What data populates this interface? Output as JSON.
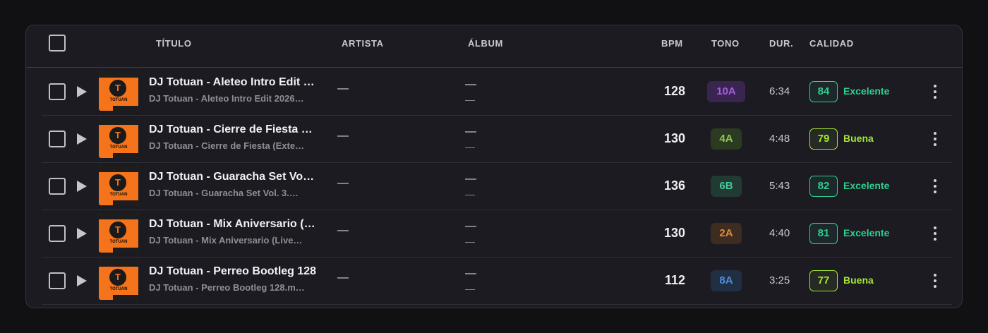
{
  "header": {
    "titulo": "TÍTULO",
    "artista": "ARTISTA",
    "album": "ÁLBUM",
    "bpm": "BPM",
    "tono": "TONO",
    "dur": "DUR.",
    "calidad": "CALIDAD"
  },
  "tracks": [
    {
      "title": "DJ Totuan - Aleteo Intro Edit …",
      "subtitle": "DJ Totuan - Aleteo Intro Edit 2026…",
      "artist": "—",
      "album": "—",
      "album_sub": "—",
      "bpm": "128",
      "key": "10A",
      "key_bg": "#3a2450",
      "key_fg": "#a45ee0",
      "duration": "6:34",
      "score": "84",
      "quality": "Excelente",
      "quality_color": "#2fcf8f",
      "cover_text": "TOTUAN",
      "cover_letter": "T"
    },
    {
      "title": "DJ Totuan - Cierre de Fiesta …",
      "subtitle": "DJ Totuan - Cierre de Fiesta (Exte…",
      "artist": "—",
      "album": "—",
      "album_sub": "—",
      "bpm": "130",
      "key": "4A",
      "key_bg": "#2c3a22",
      "key_fg": "#8fc94a",
      "duration": "4:48",
      "score": "79",
      "quality": "Buena",
      "quality_color": "#a3e635",
      "cover_text": "TOTUAN",
      "cover_letter": "T"
    },
    {
      "title": "DJ Totuan - Guaracha Set Vo…",
      "subtitle": "DJ Totuan - Guaracha Set Vol. 3.…",
      "artist": "—",
      "album": "—",
      "album_sub": "—",
      "bpm": "136",
      "key": "6B",
      "key_bg": "#213a32",
      "key_fg": "#47c8a0",
      "duration": "5:43",
      "score": "82",
      "quality": "Excelente",
      "quality_color": "#2fcf8f",
      "cover_text": "TOTUAN",
      "cover_letter": "T"
    },
    {
      "title": "DJ Totuan - Mix Aniversario (…",
      "subtitle": "DJ Totuan - Mix Aniversario (Live…",
      "artist": "—",
      "album": "—",
      "album_sub": "—",
      "bpm": "130",
      "key": "2A",
      "key_bg": "#3d2c20",
      "key_fg": "#e08a3a",
      "duration": "4:40",
      "score": "81",
      "quality": "Excelente",
      "quality_color": "#2fcf8f",
      "cover_text": "TOTUAN",
      "cover_letter": "T"
    },
    {
      "title": "DJ Totuan - Perreo Bootleg 128",
      "subtitle": "DJ Totuan - Perreo Bootleg 128.m…",
      "artist": "—",
      "album": "—",
      "album_sub": "—",
      "bpm": "112",
      "key": "8A",
      "key_bg": "#202f44",
      "key_fg": "#4f8fe0",
      "duration": "3:25",
      "score": "77",
      "quality": "Buena",
      "quality_color": "#a3e635",
      "cover_text": "TOTUAN",
      "cover_letter": "T"
    }
  ]
}
